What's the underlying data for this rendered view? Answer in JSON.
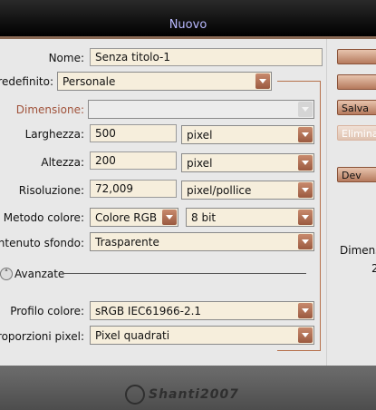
{
  "window": {
    "title": "Nuovo"
  },
  "form": {
    "nome": {
      "label": "Nome:",
      "value": "Senza titolo-1"
    },
    "predefinito": {
      "label": "Predefinito:",
      "value": "Personale"
    },
    "dimensione": {
      "label": "Dimensione:",
      "value": ""
    },
    "larghezza": {
      "label": "Larghezza:",
      "value": "500",
      "unit": "pixel"
    },
    "altezza": {
      "label": "Altezza:",
      "value": "200",
      "unit": "pixel"
    },
    "risoluzione": {
      "label": "Risoluzione:",
      "value": "72,009",
      "unit": "pixel/pollice"
    },
    "metodo_colore": {
      "label": "Metodo colore:",
      "value": "Colore RGB",
      "bits": "8 bit"
    },
    "contenuto_sfondo": {
      "label": "Contenuto sfondo:",
      "value": "Trasparente"
    },
    "avanzate": {
      "label": "Avanzate"
    },
    "profilo_colore": {
      "label": "Profilo colore:",
      "value": "sRGB IEC61966-2.1"
    },
    "proporzioni_pixel": {
      "label": "Proporzioni pixel:",
      "value": "Pixel quadrati"
    }
  },
  "buttons": {
    "ok": "",
    "annulla": "",
    "salva": "Salva",
    "elimina": "Elimina",
    "device": "Dev"
  },
  "side": {
    "dimensione_label": "Dimens",
    "dimensione_value": "2"
  },
  "watermark": "Shanti2007",
  "colors": {
    "accent": "#b6714c",
    "field_bg": "#f6eedc",
    "title_text": "#b9b9ff"
  }
}
